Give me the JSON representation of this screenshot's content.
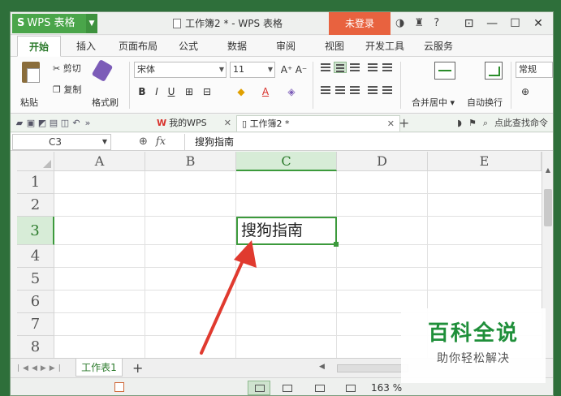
{
  "titlebar": {
    "app_name": "WPS 表格",
    "doc_title": "工作簿2 * - WPS 表格",
    "login": "未登录"
  },
  "ribbon_tabs": [
    "开始",
    "插入",
    "页面布局",
    "公式",
    "数据",
    "审阅",
    "视图",
    "开发工具",
    "云服务"
  ],
  "ribbon": {
    "paste": "粘贴",
    "cut": "剪切",
    "copy": "复制",
    "format_painter": "格式刷",
    "font": "宋体",
    "font_size": "11",
    "merge_center": "合并居中",
    "wrap_text": "自动换行",
    "number_format": "常规"
  },
  "doc_tabs": {
    "wps_tab": "我的WPS",
    "active_tab": "工作簿2 *",
    "search": "点此查找命令"
  },
  "formula_bar": {
    "cell_ref": "C3",
    "fx": "fx",
    "content": "搜狗指南"
  },
  "grid": {
    "columns": [
      "A",
      "B",
      "C",
      "D",
      "E"
    ],
    "rows": [
      "1",
      "2",
      "3",
      "4",
      "5",
      "6",
      "7",
      "8"
    ],
    "active_cell_value": "搜狗指南"
  },
  "sheets": {
    "tabs": [
      "工作表1"
    ]
  },
  "statusbar": {
    "zoom": "163 %"
  },
  "watermark": {
    "title": "百科全说",
    "subtitle": "助你轻松解决"
  },
  "colors": {
    "accent_green": "#3c9a3c",
    "login_orange": "#e8623f",
    "arrow_red": "#e03a2f"
  }
}
